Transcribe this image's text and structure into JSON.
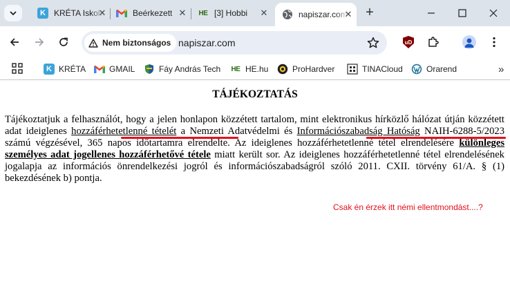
{
  "browser": {
    "tabs": [
      {
        "title": "KRÉTA Iskolai",
        "icon": "kreta-icon",
        "active": false
      },
      {
        "title": "Beérkezett",
        "icon": "gmail-icon",
        "active": false
      },
      {
        "title": "[3] Hobbi",
        "icon": "he-icon",
        "active": false
      },
      {
        "title": "napiszar.com",
        "icon": "globe-icon",
        "active": true
      }
    ],
    "security_label": "Nem biztonságos",
    "url": "napiszar.com",
    "bookmarks": [
      {
        "label": "KRÉTA",
        "icon": "kreta-icon"
      },
      {
        "label": "GMAIL",
        "icon": "gmail-icon"
      },
      {
        "label": "Fáy András Tech",
        "icon": "shield-logo-icon"
      },
      {
        "label": "HE.hu",
        "icon": "he-icon"
      },
      {
        "label": "ProHardver",
        "icon": "prohardver-icon"
      },
      {
        "label": "TINACloud",
        "icon": "tinacloud-icon"
      },
      {
        "label": "Orarend",
        "icon": "wordpress-icon"
      }
    ],
    "extension_label": "uD"
  },
  "page": {
    "title": "TÁJÉKOZTATÁS",
    "paragraph": {
      "t1": "Tájékoztatjuk a felhasználót, hogy a jelen honlapon közzétett tartalom, mint elektronikus hírközlő hálózat útján közzétett adat ideiglenes ",
      "u1": "hozzáférhetetlenné tételét",
      "t2": " a Nemzeti Adatvédelmi és ",
      "u2": "Információszabadság Hatóság",
      "t3": " NAIH-6288-5/2023 számú végzésével, 365 napos időtartamra elrendelte. Az ideiglenes hozzáférhetetlenné tétel elrendelésére ",
      "u3": "különleges személyes adat jogellenes hozzáférhetővé tétele",
      "t4": " miatt került sor. Az ideiglenes hozzáférhetetlenné tétel elrendelésének jogalapja az információs önrendelkezési jogról és információszabadságról szóló 2011. CXII. törvény 61/A. § (1) bekezdésének b) pontja."
    },
    "comment": "Csak én érzek itt némi ellentmondást....?",
    "annotation_color": "#e8101a"
  }
}
